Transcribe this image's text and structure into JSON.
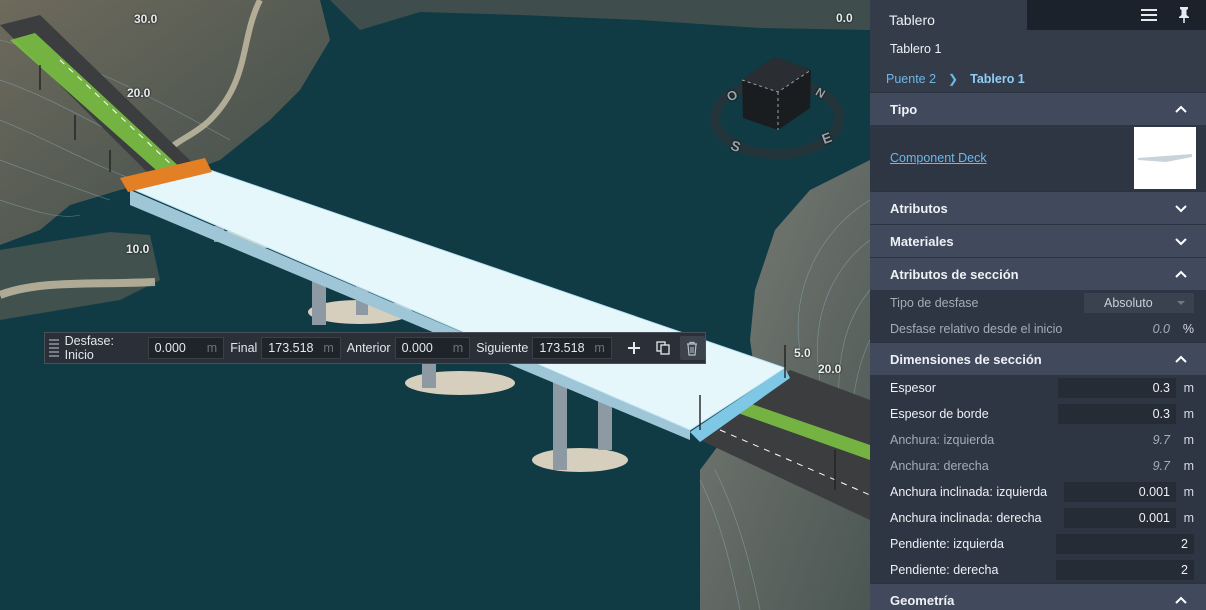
{
  "viewport": {
    "contour_labels": [
      "30.0",
      "0.0",
      "20.0",
      "10.0",
      "5.0",
      "20.0"
    ],
    "compass": [
      "O",
      "S",
      "E",
      "N"
    ]
  },
  "toolbar": {
    "offset_label": "Desfase: Inicio",
    "start_value": "0.000",
    "final_label": "Final",
    "final_value": "173.518",
    "previous_label": "Anterior",
    "previous_value": "0.000",
    "next_label": "Siguiente",
    "next_value": "173.518",
    "unit": "m"
  },
  "panel": {
    "tab_title": "Tablero",
    "subtitle": "Tablero 1",
    "breadcrumb": [
      "Puente 2",
      "Tablero 1"
    ],
    "sections": {
      "tipo": "Tipo",
      "atributos": "Atributos",
      "materiales": "Materiales",
      "atributos_seccion": "Atributos de sección",
      "dimensiones": "Dimensiones de sección",
      "geometria": "Geometría"
    },
    "component_link": "Component Deck",
    "offset_type_label": "Tipo de desfase",
    "offset_type_value": "Absoluto",
    "relative_offset_label": "Desfase relativo desde el inicio",
    "relative_offset_value": "0.0",
    "relative_offset_unit": "%",
    "dimensions": [
      {
        "label": "Espesor",
        "value": "0.3",
        "unit": "m"
      },
      {
        "label": "Espesor de borde",
        "value": "0.3",
        "unit": "m"
      },
      {
        "label": "Anchura: izquierda",
        "value": "9.7",
        "unit": "m"
      },
      {
        "label": "Anchura: derecha",
        "value": "9.7",
        "unit": "m"
      },
      {
        "label": "Anchura inclinada: izquierda",
        "value": "0.001",
        "unit": "m"
      },
      {
        "label": "Anchura inclinada: derecha",
        "value": "0.001",
        "unit": "m"
      },
      {
        "label": "Pendiente: izquierda",
        "value": "2",
        "unit": ""
      },
      {
        "label": "Pendiente: derecha",
        "value": "2",
        "unit": ""
      }
    ]
  },
  "colors": {
    "water": "#103a44",
    "deck": "#e6f7fc",
    "grass": "#7bc043",
    "accent_link": "#6cb8e8",
    "panel_bg": "#343c4a",
    "section_bg": "#404a5c"
  },
  "icons": [
    "menu-icon",
    "pin-icon",
    "add-icon",
    "copy-icon",
    "delete-icon",
    "chevron-up-icon",
    "chevron-down-icon",
    "chevron-right-icon",
    "grip-icon"
  ]
}
